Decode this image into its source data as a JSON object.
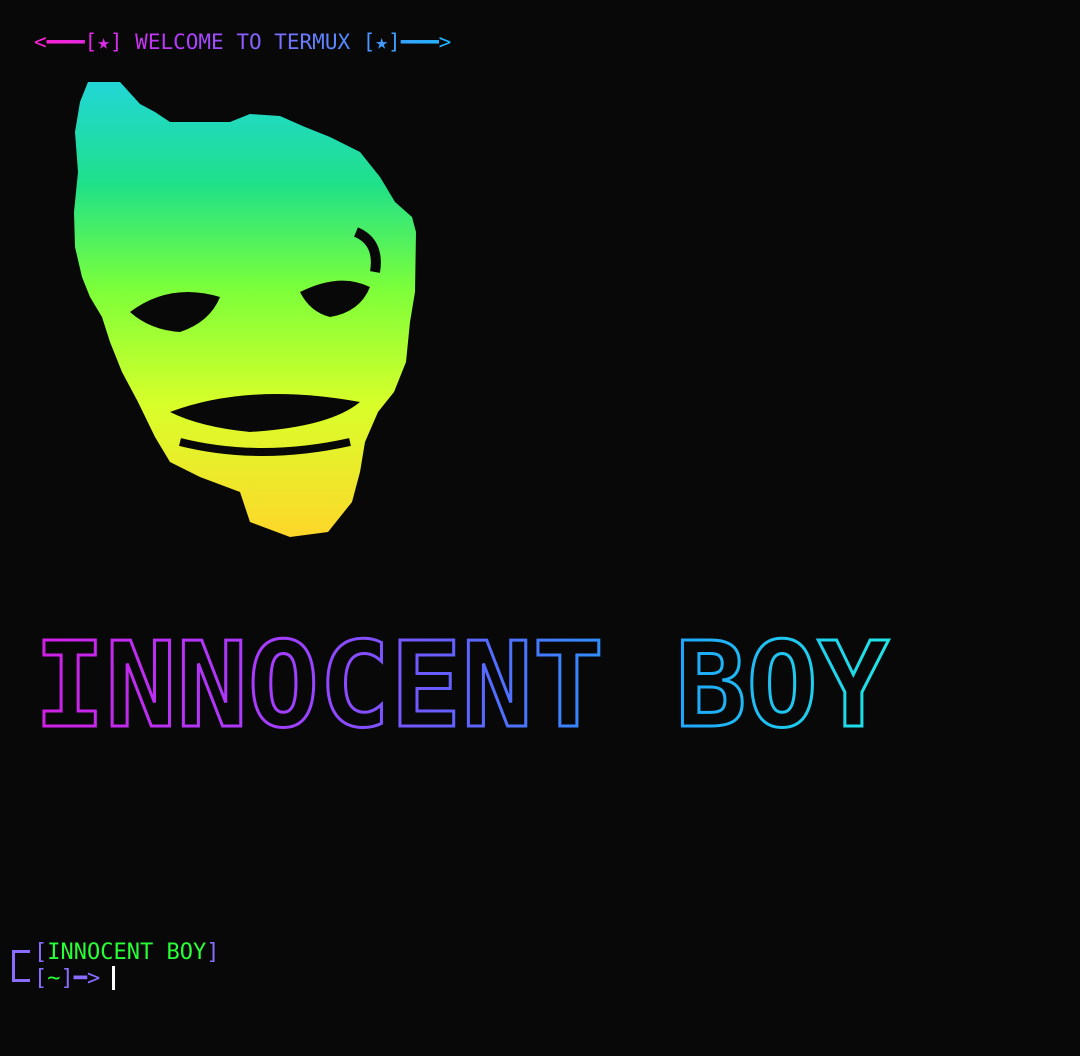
{
  "terminal": {
    "welcome": {
      "arrow_left": "<━━━",
      "star_left": "[★]",
      "text": "WELCOME TO TERMUX",
      "star_right": "[★]",
      "arrow_right": "━━━>"
    },
    "ascii_art": {
      "icon": "joker-face-icon",
      "colors": [
        "#22d6d6",
        "#1fe08a",
        "#7cff3a",
        "#d8ff2a",
        "#ffd52a"
      ]
    },
    "banner": {
      "text": "INNOCENT BOY",
      "colors": [
        "#d21fe6",
        "#a63dff",
        "#5f62ff",
        "#1f9dff",
        "#1fe6e6"
      ]
    },
    "prompt": {
      "bracket_open": "[",
      "name": "INNOCENT BOY",
      "bracket_close": "]",
      "path_open": "[",
      "path": "~",
      "path_close": "]",
      "arrow": "━>"
    }
  }
}
